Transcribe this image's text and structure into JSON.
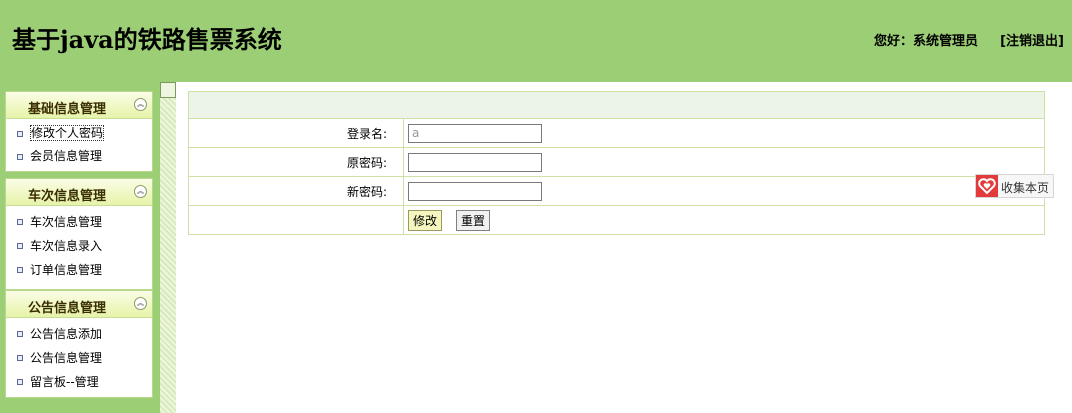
{
  "header": {
    "title": "基于java的铁路售票系统",
    "greeting_prefix": "您好：",
    "user_role": "系统管理员",
    "logout_label": "[注销退出]"
  },
  "sidebar": {
    "groups": [
      {
        "title": "基础信息管理",
        "items": [
          "修改个人密码",
          "会员信息管理"
        ]
      },
      {
        "title": "车次信息管理",
        "items": [
          "车次信息管理",
          "车次信息录入",
          "订单信息管理"
        ]
      },
      {
        "title": "公告信息管理",
        "items": [
          "公告信息添加",
          "公告信息管理",
          "留言板--管理"
        ]
      }
    ]
  },
  "form": {
    "username_label": "登录名:",
    "username_value": "a",
    "old_password_label": "原密码:",
    "new_password_label": "新密码:",
    "submit_label": "修改",
    "reset_label": "重置"
  },
  "favorite": {
    "label": "收集本页"
  },
  "colors": {
    "header_bg": "#9ccf75",
    "menu_header_gradient_top": "#fbfde6",
    "menu_header_gradient_bottom": "#e6f3a9",
    "table_border": "#cfe0a8",
    "table_head_bg": "#ecf4e8",
    "favorite_icon": "#e23b3b"
  }
}
